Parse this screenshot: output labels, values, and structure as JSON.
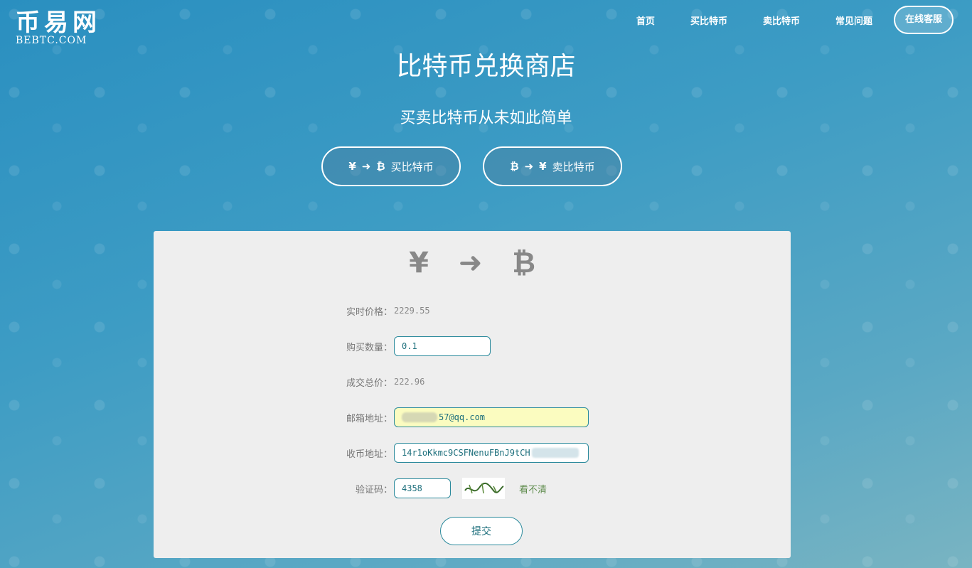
{
  "logo": {
    "cn": "币易网",
    "en": "BEBTC.COM"
  },
  "nav": {
    "home": "首页",
    "buy": "买比特币",
    "sell": "卖比特币",
    "faq": "常见问题",
    "service": "在线客服"
  },
  "hero": {
    "title": "比特币兑换商店",
    "subtitle": "买卖比特币从未如此简单",
    "buy_btn": {
      "from": "¥",
      "arrow": "➜",
      "to": "₿",
      "label": "买比特币"
    },
    "sell_btn": {
      "from": "₿",
      "arrow": "➜",
      "to": "¥",
      "label": "卖比特币"
    }
  },
  "panel": {
    "flow": {
      "from": "¥",
      "arrow": "➜",
      "to": "₿"
    },
    "price_label": "实时价格：",
    "price_value": "2229.55",
    "qty_label": "购买数量：",
    "qty_value": "0.1",
    "total_label": "成交总价：",
    "total_value": "222.96",
    "email_label": "邮箱地址：",
    "email_value": "57@qq.com",
    "address_label": "收币地址：",
    "address_value": "14r1oKkmc9CSFNenuFBnJ9tCH",
    "captcha_label": "验证码：",
    "captcha_value": "4358",
    "refresh_label": "看不清",
    "submit_label": "提交"
  },
  "colors": {
    "accent": "#2b8a9c",
    "panel_bg": "#eeeeee",
    "email_bg": "#fbfcc0"
  }
}
